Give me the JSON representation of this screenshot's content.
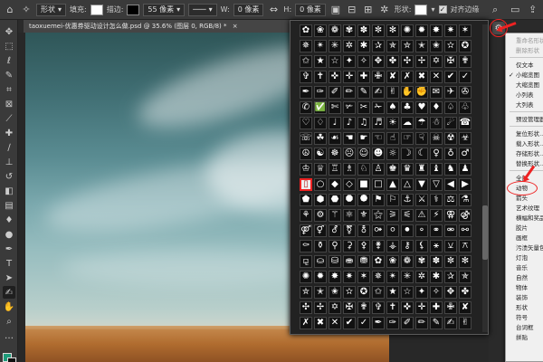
{
  "options": {
    "mode_label": "形状",
    "fill_label": "填充:",
    "stroke_label": "描边:",
    "stroke_width": "55 像素",
    "w_label": "W:",
    "w_value": "0 像素",
    "h_label": "H:",
    "h_value": "0 像素",
    "shape_label": "形状:",
    "align_label": "对齐边缘",
    "align_checked": true,
    "fill_color": "#ffffff",
    "stroke_color": "#000000"
  },
  "document_tab": {
    "title": "taoxuemei-优惠券驱动设计怎么做.psd @ 35.6% (图层 0, RGB/8) *",
    "close": "×"
  },
  "tools": [
    "move-tool",
    "marquee-tool",
    "lasso-tool",
    "quick-select-tool",
    "crop-tool",
    "frame-tool",
    "eyedropper-tool",
    "healing-tool",
    "brush-tool",
    "stamp-tool",
    "history-brush-tool",
    "eraser-tool",
    "gradient-tool",
    "blur-tool",
    "dodge-tool",
    "pen-tool",
    "type-tool",
    "path-select-tool",
    "custom-shape-tool",
    "hand-tool",
    "zoom-tool"
  ],
  "colors": {
    "foreground": "#1e9a7a",
    "background": "#111111",
    "accent": "#e22222"
  },
  "shape_picker": {
    "selected_index": 120
  },
  "menu": {
    "items": [
      {
        "label": "重命名形状",
        "disabled": true
      },
      {
        "label": "删除形状",
        "disabled": true
      },
      {
        "sep": true
      },
      {
        "label": "仅文本"
      },
      {
        "label": "小缩览图",
        "checked": true
      },
      {
        "label": "大缩览图"
      },
      {
        "label": "小列表"
      },
      {
        "label": "大列表"
      },
      {
        "sep": true
      },
      {
        "label": "预设管理器..."
      },
      {
        "sep": true
      },
      {
        "label": "复位形状..."
      },
      {
        "label": "载入形状..."
      },
      {
        "label": "存储形状..."
      },
      {
        "label": "替换形状..."
      },
      {
        "sep": true
      },
      {
        "label": "全部"
      },
      {
        "label": "动物"
      },
      {
        "label": "箭头"
      },
      {
        "label": "艺术纹理"
      },
      {
        "label": "横幅和奖品"
      },
      {
        "label": "胶片"
      },
      {
        "label": "画框"
      },
      {
        "label": "污渍矢量包"
      },
      {
        "label": "灯泡"
      },
      {
        "label": "音乐"
      },
      {
        "label": "自然"
      },
      {
        "label": "物体"
      },
      {
        "label": "装饰"
      },
      {
        "label": "形状"
      },
      {
        "label": "符号"
      },
      {
        "label": "台词框"
      },
      {
        "label": "拼贴"
      }
    ]
  }
}
